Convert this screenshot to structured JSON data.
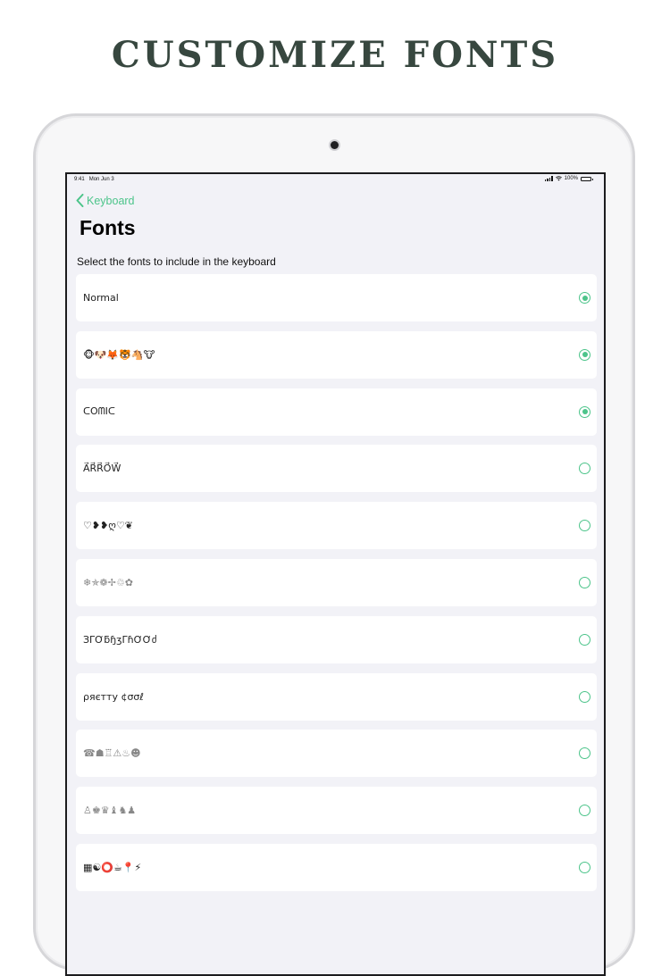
{
  "promo": {
    "title": "CUSTOMIZE FONTS"
  },
  "status_bar": {
    "time": "9:41",
    "date": "Mon Jun 3",
    "battery": "100%"
  },
  "nav": {
    "back_label": "Keyboard"
  },
  "page": {
    "title": "Fonts",
    "section_header": "Select the fonts to include in the keyboard"
  },
  "fonts": [
    {
      "label": "Normal",
      "selected": true
    },
    {
      "label": "🐵🐶🦊🐯🐴🐮",
      "selected": true
    },
    {
      "label": "ᑕOᗰIᑕ",
      "selected": true
    },
    {
      "label": "A⃗R⃗R⃗O⃗W⃗",
      "selected": false
    },
    {
      "label": "♡❥❥ღ♡❦",
      "selected": false
    },
    {
      "label": "❄✯❁✢♲✿",
      "selected": false
    },
    {
      "label": "ЗᒥƠƃɧʒᒥɦƠƠძ",
      "selected": false
    },
    {
      "label": "ρяєтту ¢σσℓ",
      "selected": false
    },
    {
      "label": "☎☗♖⚠♨☻",
      "selected": false
    },
    {
      "label": "♙♚♛♝♞♟",
      "selected": false
    },
    {
      "label": "▦☯⭕☕📍⚡",
      "selected": false
    }
  ],
  "colors": {
    "accent": "#4cc48a",
    "promo_title": "#37473f",
    "list_background": "#f2f2f7"
  }
}
